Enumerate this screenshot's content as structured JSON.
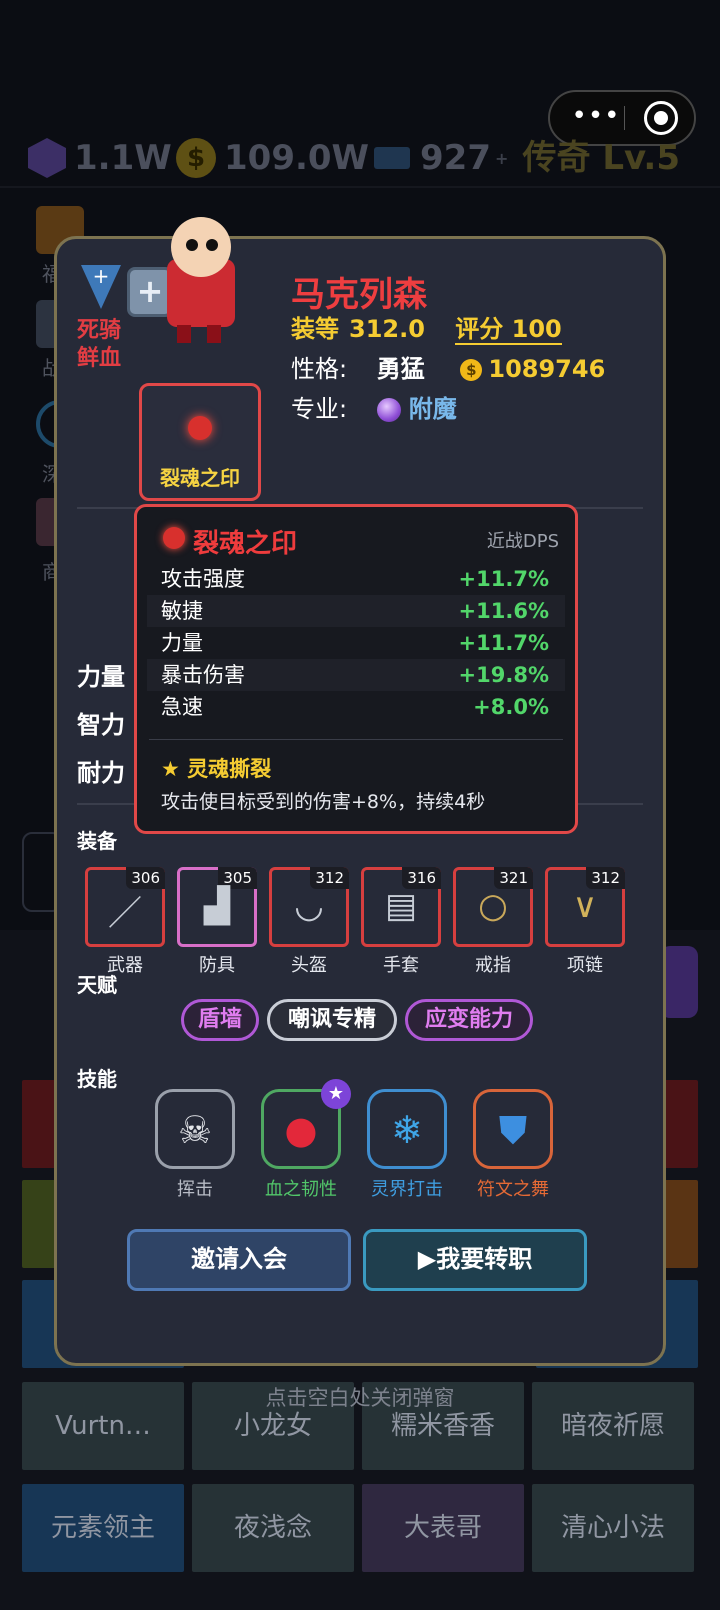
{
  "capsule": {
    "more_glyph": "•••"
  },
  "resources": {
    "gems": "1.1W",
    "gold": "109.0W",
    "tickets": "927",
    "rank": "传奇 Lv.5",
    "coin_glyph": "$",
    "plus": "+"
  },
  "side_menu": [
    "福",
    "战",
    "深",
    "商"
  ],
  "bg_grid": {
    "row1": [
      "Vurtn…",
      "小龙女",
      "糯米香香",
      "暗夜祈愿"
    ],
    "row2": [
      "元素领主",
      "夜浅念",
      "大表哥",
      "清心小法"
    ]
  },
  "close_hint": "点击空白处关闭弹窗",
  "character": {
    "spec": "死骑鲜血",
    "name": "马克列森",
    "gear_label": "装等",
    "gear_value": "312.0",
    "score_label": "评分",
    "score_value": "100",
    "personality_label": "性格:",
    "personality_value": "勇猛",
    "gold": "1089746",
    "profession_label": "专业:",
    "profession_value": "附魔"
  },
  "trinket": {
    "name": "裂魂之印"
  },
  "stats": {
    "labels": [
      "力量",
      "智力",
      "耐力"
    ]
  },
  "tooltip": {
    "name": "裂魂之印",
    "category": "近战DPS",
    "rows": [
      {
        "k": "攻击强度",
        "v": "+11.7%"
      },
      {
        "k": "敏捷",
        "v": "+11.6%"
      },
      {
        "k": "力量",
        "v": "+11.7%"
      },
      {
        "k": "暴击伤害",
        "v": "+19.8%"
      },
      {
        "k": "急速",
        "v": "+8.0%"
      }
    ],
    "perk": "★ 灵魂撕裂",
    "desc": "攻击使目标受到的伤害+8%，持续4秒"
  },
  "equipment": {
    "title": "装备",
    "items": [
      {
        "label": "武器",
        "ilvl": "306",
        "icon": "sword-icon"
      },
      {
        "label": "防具",
        "ilvl": "305",
        "icon": "armor-icon"
      },
      {
        "label": "头盔",
        "ilvl": "312",
        "icon": "helmet-icon"
      },
      {
        "label": "手套",
        "ilvl": "316",
        "icon": "gloves-icon"
      },
      {
        "label": "戒指",
        "ilvl": "321",
        "icon": "ring-icon"
      },
      {
        "label": "项链",
        "ilvl": "312",
        "icon": "necklace-icon"
      }
    ]
  },
  "talents": {
    "title": "天赋",
    "items": [
      "盾墙",
      "嘲讽专精",
      "应变能力"
    ]
  },
  "skills": {
    "title": "技能",
    "items": [
      {
        "label": "挥击",
        "icon": "skull-icon",
        "color": "#b8bcc6"
      },
      {
        "label": "血之韧性",
        "icon": "blood-drop-icon",
        "color": "#52c76a"
      },
      {
        "label": "灵界打击",
        "icon": "snowflake-icon",
        "color": "#3f9ee0"
      },
      {
        "label": "符文之舞",
        "icon": "shield-icon",
        "color": "#e56a35"
      }
    ],
    "star_glyph": "★"
  },
  "buttons": {
    "invite": "邀请入会",
    "transfer": "▶我要转职"
  },
  "colors": {
    "accent_red": "#e14848",
    "gold": "#f5cc32",
    "green": "#52d66a",
    "panel": "#262a38"
  }
}
